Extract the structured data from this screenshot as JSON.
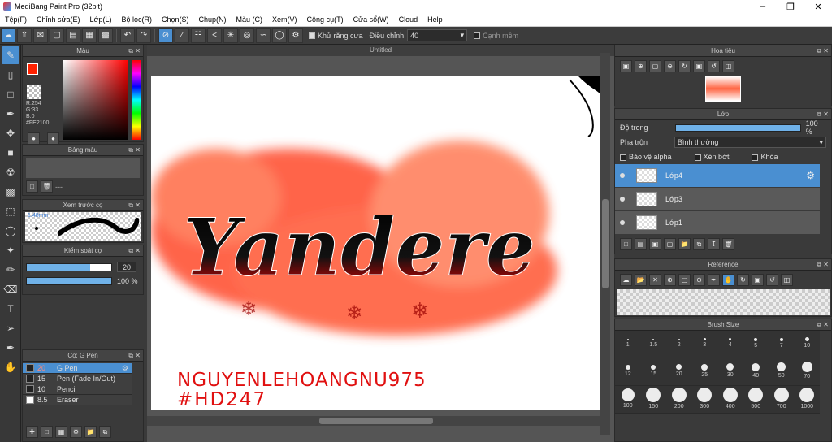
{
  "app": {
    "title": "MediBang Paint Pro (32bit)"
  },
  "menu": [
    "Tệp(F)",
    "Chỉnh sửa(E)",
    "Lớp(L)",
    "Bộ lọc(R)",
    "Chọn(S)",
    "Chụp(N)",
    "Màu (C)",
    "Xem(V)",
    "Công cụ(T)",
    "Cửa sổ(W)",
    "Cloud",
    "Help"
  ],
  "toolbar": {
    "antialias_label": "Khử răng cưa",
    "adjust_label": "Điều chỉnh",
    "adjust_value": "40",
    "smooth_label": "Cạnh mềm"
  },
  "color_panel": {
    "title": "Màu",
    "r": "R:254",
    "g": "G:33",
    "b": "B:0",
    "hex": "#FE2100",
    "fg": "#fe2100"
  },
  "palette_panel": {
    "title": "Bảng màu",
    "value": "---"
  },
  "brush_preview": {
    "title": "Xem trước cọ",
    "size": "1.48mm"
  },
  "brush_control": {
    "title": "Kiểm soát cọ",
    "size_value": "20",
    "size_fraction": 0.75,
    "opacity_value": "100 %",
    "opacity_fraction": 1.0
  },
  "brush_list": {
    "title": "Cọ: G Pen",
    "items": [
      {
        "size": "20",
        "name": "G Pen",
        "active": true,
        "color": "#222"
      },
      {
        "size": "15",
        "name": "Pen (Fade In/Out)",
        "active": false,
        "color": "#222"
      },
      {
        "size": "10",
        "name": "Pencil",
        "active": false,
        "color": "#222"
      },
      {
        "size": "8.5",
        "name": "Eraser",
        "active": false,
        "color": "#fff"
      }
    ]
  },
  "canvas": {
    "tab": "Untitled",
    "text": {
      "title": "Yandere",
      "signature1": "NGUYENLEHOANGNU975",
      "signature2": "#HD247"
    }
  },
  "navigator": {
    "title": "Hoa tiêu"
  },
  "layer_panel": {
    "title": "Lớp",
    "opacity_label": "Độ trong",
    "opacity_value": "100 %",
    "opacity_fraction": 1.0,
    "blend_label": "Pha trộn",
    "blend_value": "Bình thường",
    "protect_alpha": "Bảo vệ alpha",
    "clip": "Xén bớt",
    "lock": "Khóa",
    "layers": [
      {
        "name": "Lớp4",
        "active": true
      },
      {
        "name": "Lớp3",
        "active": false
      },
      {
        "name": "Lớp1",
        "active": false
      }
    ]
  },
  "reference": {
    "title": "Reference"
  },
  "brush_size": {
    "title": "Brush Size",
    "sizes": [
      "1",
      "1.5",
      "2",
      "3",
      "4",
      "5",
      "7",
      "10",
      "12",
      "15",
      "20",
      "25",
      "30",
      "40",
      "50",
      "70",
      "100",
      "150",
      "200",
      "300",
      "400",
      "500",
      "700",
      "1000"
    ]
  }
}
